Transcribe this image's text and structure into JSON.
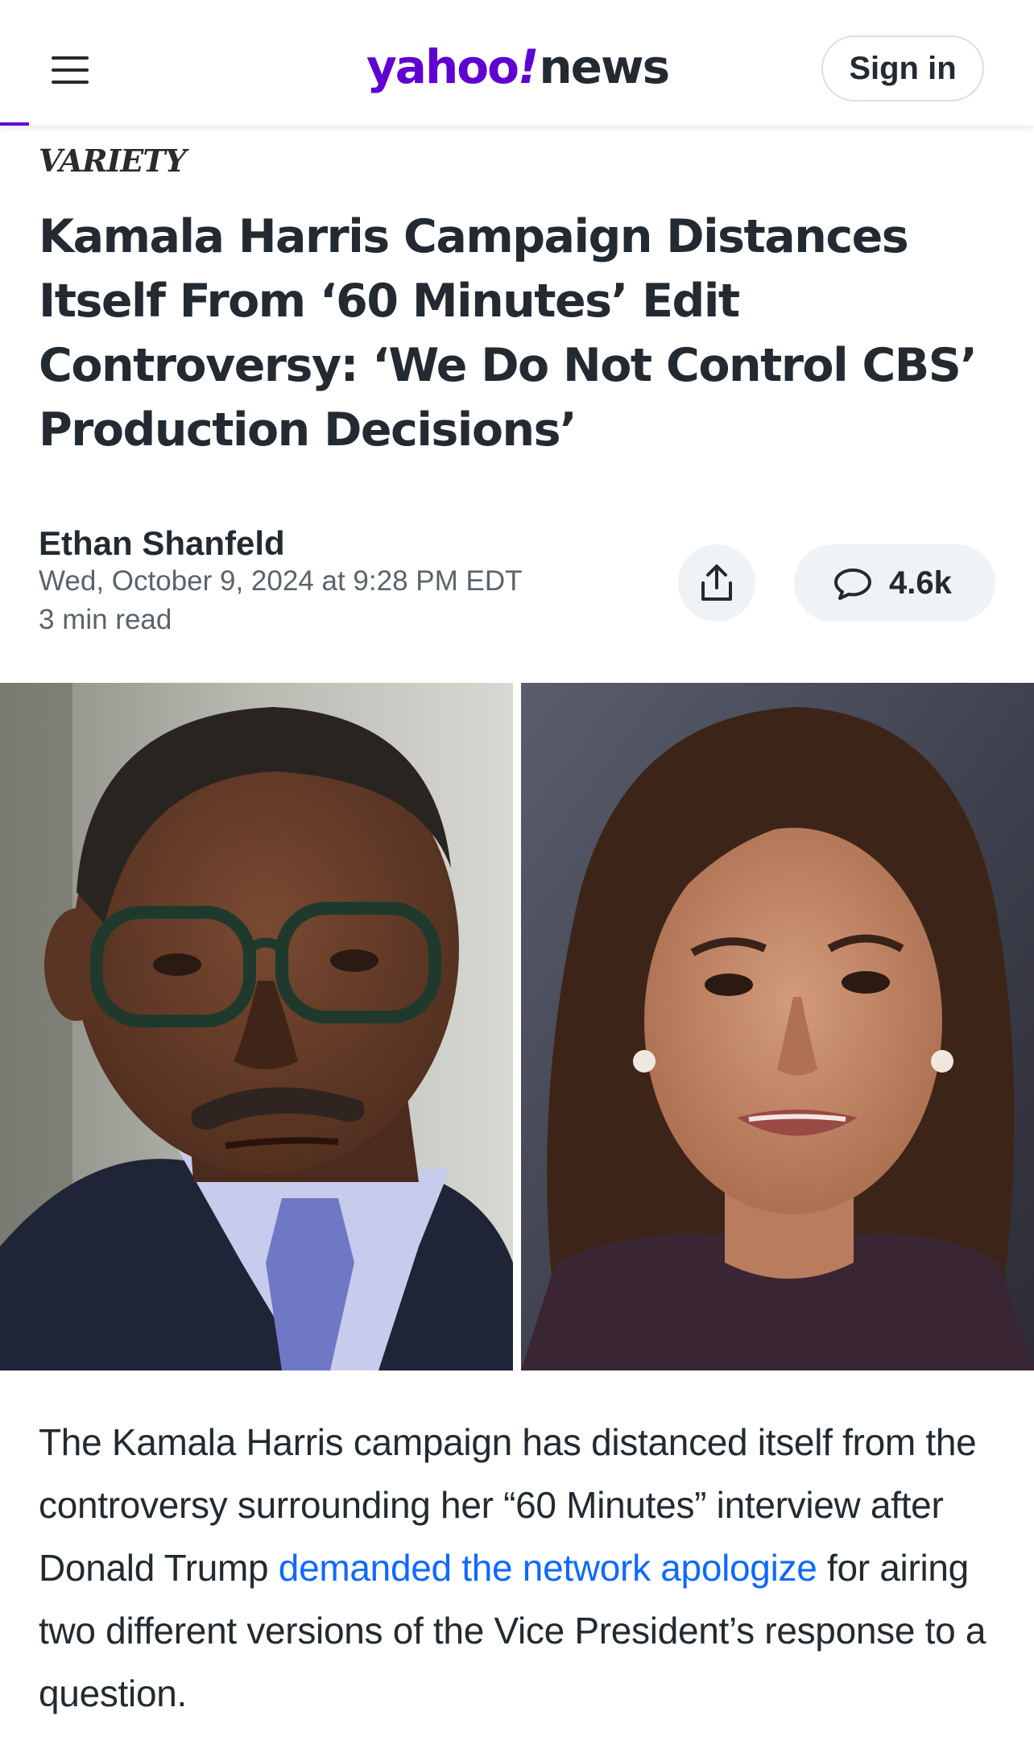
{
  "header": {
    "logo_yahoo": "yahoo",
    "logo_bang": "!",
    "logo_news": "news",
    "sign_in_label": "Sign in",
    "brand_color": "#6001d2"
  },
  "article": {
    "source": "VARIETY",
    "headline": "Kamala Harris Campaign Distances Itself From ‘60 Minutes’ Edit Controversy: ‘We Do Not Control CBS’ Production Decisions’",
    "author": "Ethan Shanfeld",
    "date": "Wed, October 9, 2024 at 9:28 PM EDT",
    "read_time": "3 min read",
    "comments_count": "4.6k",
    "body": {
      "text_1": "The Kamala Harris campaign has distanced itself from the controversy surrounding her “60 Minutes” interview after Donald Trump ",
      "link_text": "demanded the network apologize",
      "text_2": " for airing two different versions of the Vice President’s response to a question."
    }
  },
  "colors": {
    "text": "#232a31",
    "muted": "#5b636a",
    "link": "#0f69ff",
    "button_bg": "#f0f3f5"
  },
  "icons": [
    "menu-icon",
    "share-icon",
    "comment-icon"
  ]
}
